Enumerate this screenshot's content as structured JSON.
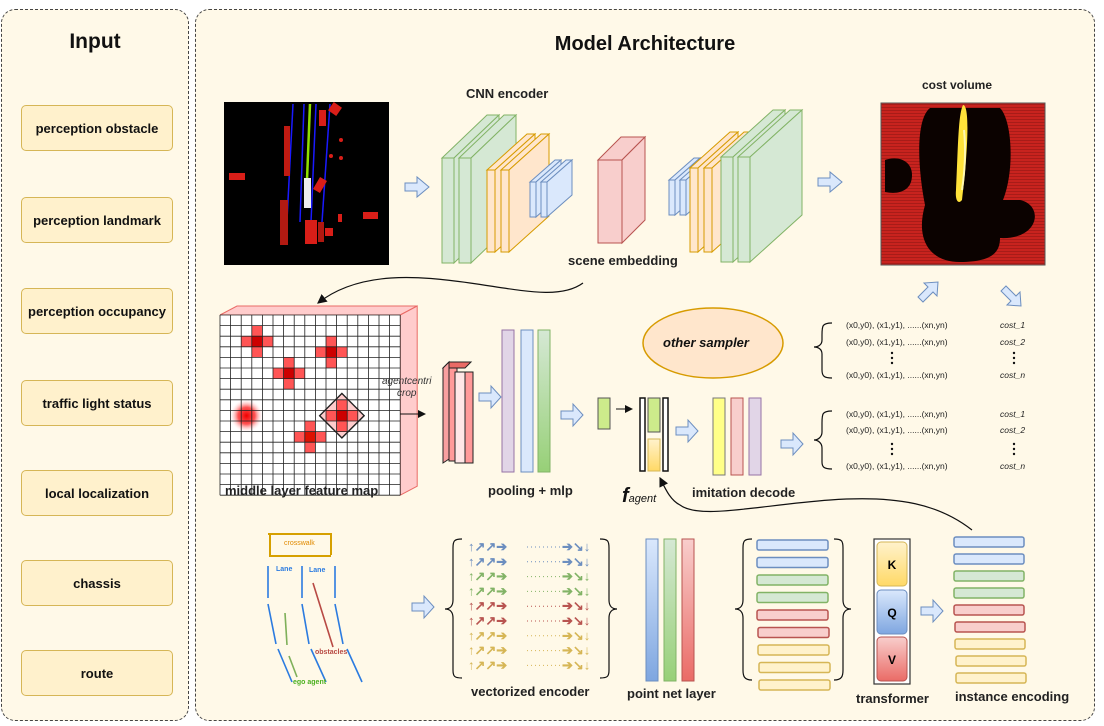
{
  "input_panel": {
    "title": "Input",
    "items": [
      "perception obstacle",
      "perception landmark",
      "perception occupancy",
      "traffic light status",
      "local localization",
      "chassis",
      "route"
    ]
  },
  "model_panel": {
    "title": "Model Architecture",
    "cnn_encoder_label": "CNN encoder",
    "scene_embedding_label": "scene embedding",
    "cost_volume_label": "cost volume",
    "feature_map_label": "middle layer feature map",
    "crop_label_line1": "agentcentri",
    "crop_label_line2": "crop",
    "pooling_label": "pooling + mlp",
    "other_sampler_label": "other sampler",
    "f_agent_main": "f",
    "f_agent_sub": "agent",
    "imitation_decode_label": "imitation decode",
    "vectorized_encoder_label": "vectorized encoder",
    "point_net_label": "point net layer",
    "transformer_label": "transformer",
    "instance_encoding_label": "instance encoding",
    "transformer_blocks": [
      "K",
      "Q",
      "V"
    ],
    "scene_sketch": {
      "crosswalk": "crosswalk",
      "lane1": "Lane",
      "lane2": "Lane",
      "obstacles": "obstacles",
      "ego": "ego agent"
    },
    "trajectory_groups": [
      {
        "rows": [
          {
            "traj": "(x0,y0), (x1,y1), ......(xn,yn)",
            "cost": "cost_1"
          },
          {
            "traj": "(x0,y0), (x1,y1), ......(xn,yn)",
            "cost": "cost_2"
          },
          {
            "traj": "(x0,y0), (x1,y1), ......(xn,yn)",
            "cost": "cost_n"
          }
        ]
      },
      {
        "rows": [
          {
            "traj": "(x0,y0), (x1,y1), ......(xn,yn)",
            "cost": "cost_1"
          },
          {
            "traj": "(x0,y0), (x1,y1), ......(xn,yn)",
            "cost": "cost_2"
          },
          {
            "traj": "(x0,y0), (x1,y1), ......(xn,yn)",
            "cost": "cost_n"
          }
        ]
      }
    ],
    "colors": {
      "green": "#d5e8d4",
      "green_stroke": "#82b366",
      "orange": "#ffe6cc",
      "orange_stroke": "#d79b00",
      "blue": "#dae8fc",
      "blue_stroke": "#6c8ebf",
      "red": "#f8cecc",
      "red_stroke": "#b85450",
      "yellow": "#fff2cc",
      "yellow_stroke": "#d6b656",
      "purple": "#e1d5e7",
      "purple_stroke": "#9673a6"
    }
  }
}
